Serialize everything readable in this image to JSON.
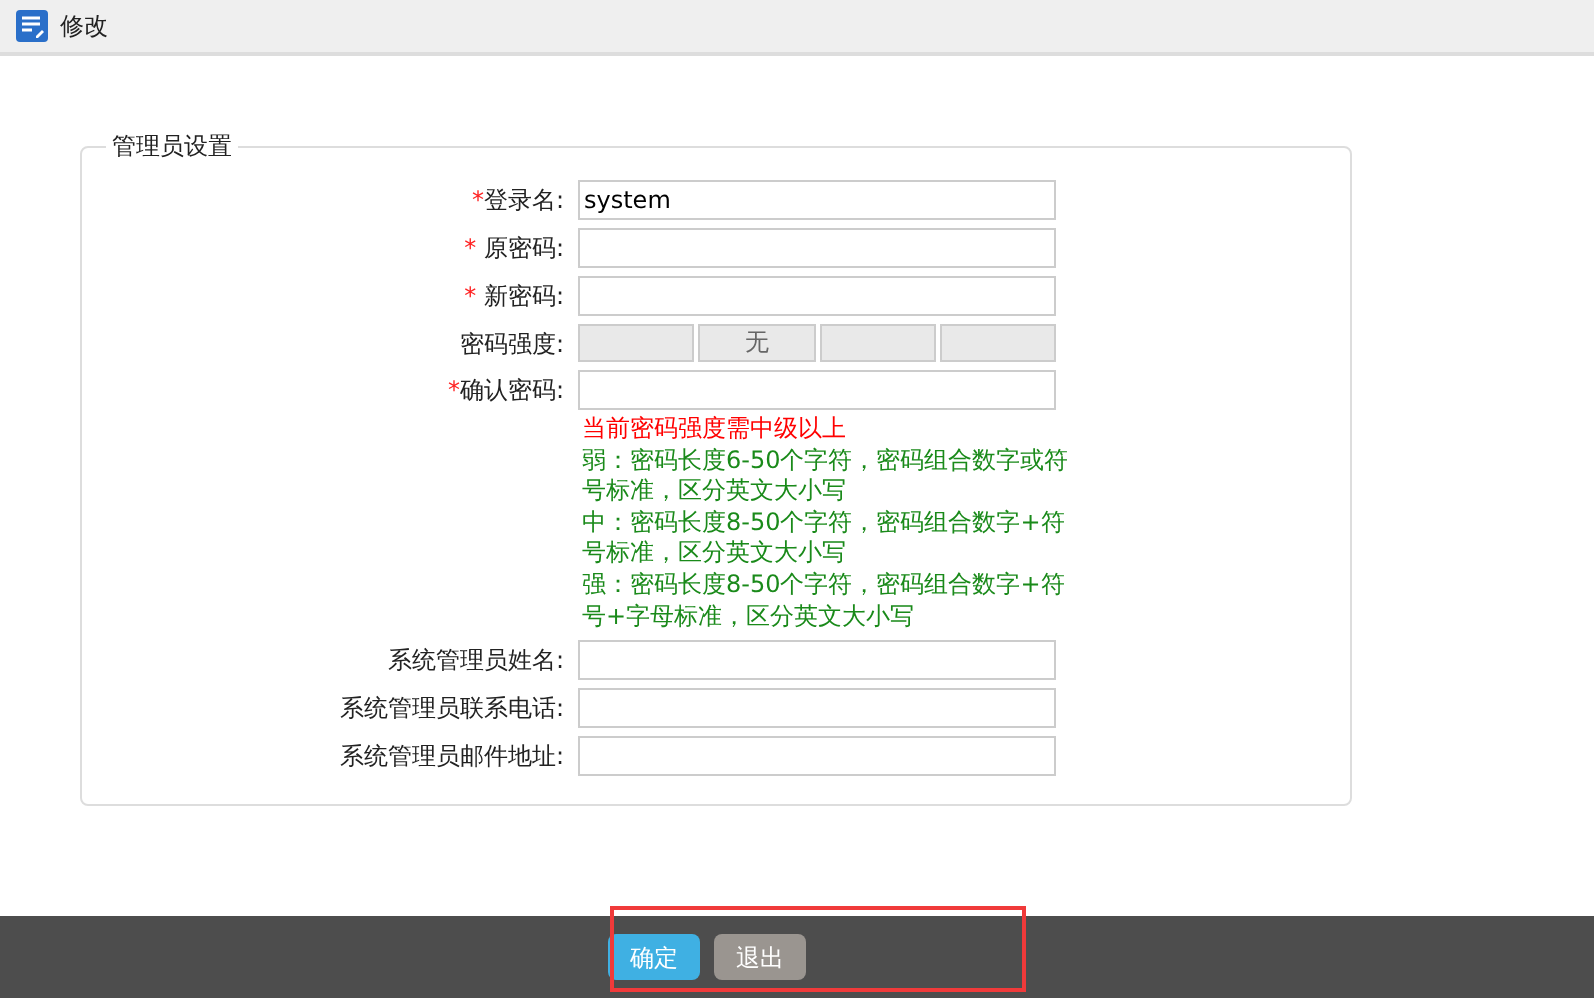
{
  "header": {
    "title": "修改"
  },
  "fieldset": {
    "legend": "管理员设置",
    "fields": [
      {
        "kind": "input",
        "required_mark": "*",
        "label": "登录名:",
        "value": "system"
      },
      {
        "kind": "input",
        "required_mark": "* ",
        "label": "原密码:"
      },
      {
        "kind": "input",
        "required_mark": "* ",
        "label": "新密码:"
      },
      {
        "kind": "meter",
        "label": "密码强度:",
        "text": "无"
      },
      {
        "kind": "input",
        "required_mark": "*",
        "label": "确认密码:"
      },
      {
        "kind": "hints",
        "lines": [
          {
            "kind": "warning",
            "text": "当前密码强度需中级以上"
          },
          {
            "kind": "rule",
            "text": "弱：密码长度6-50个字符，密码组合数字或符号标准，区分英文大小写"
          },
          {
            "kind": "rule",
            "text": "中：密码长度8-50个字符，密码组合数字+符号标准，区分英文大小写"
          },
          {
            "kind": "rule",
            "text": "强：密码长度8-50个字符，密码组合数字+符号+字母标准，区分英文大小写"
          }
        ]
      },
      {
        "kind": "input",
        "label": "系统管理员姓名:"
      },
      {
        "kind": "input",
        "label": "系统管理员联系电话:"
      },
      {
        "kind": "input",
        "label": "系统管理员邮件地址:"
      }
    ]
  },
  "footer": {
    "highlighted": true,
    "buttons": [
      {
        "label": "确定",
        "kind": "primary"
      },
      {
        "label": "退出",
        "kind": "secondary"
      }
    ]
  }
}
